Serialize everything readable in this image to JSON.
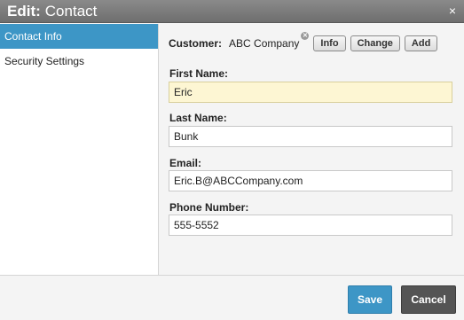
{
  "dialog": {
    "title_prefix": "Edit:",
    "title_main": "Contact",
    "close_symbol": "×"
  },
  "sidebar": {
    "items": [
      {
        "label": "Contact Info",
        "active": true
      },
      {
        "label": "Security Settings",
        "active": false
      }
    ]
  },
  "customer": {
    "label": "Customer:",
    "value": "ABC Company",
    "clear_icon": "remove-icon",
    "buttons": {
      "info": "Info",
      "change": "Change",
      "add": "Add"
    }
  },
  "fields": {
    "first_name": {
      "label": "First Name:",
      "value": "Eric"
    },
    "last_name": {
      "label": "Last Name:",
      "value": "Bunk"
    },
    "email": {
      "label": "Email:",
      "value": "Eric.B@ABCCompany.com"
    },
    "phone": {
      "label": "Phone Number:",
      "value": "555-5552"
    }
  },
  "footer": {
    "save_label": "Save",
    "cancel_label": "Cancel"
  },
  "colors": {
    "accent": "#3d96c6",
    "titlebar": "#7a7a7a",
    "cancel": "#545454",
    "focused_input": "#fdf6d3"
  }
}
